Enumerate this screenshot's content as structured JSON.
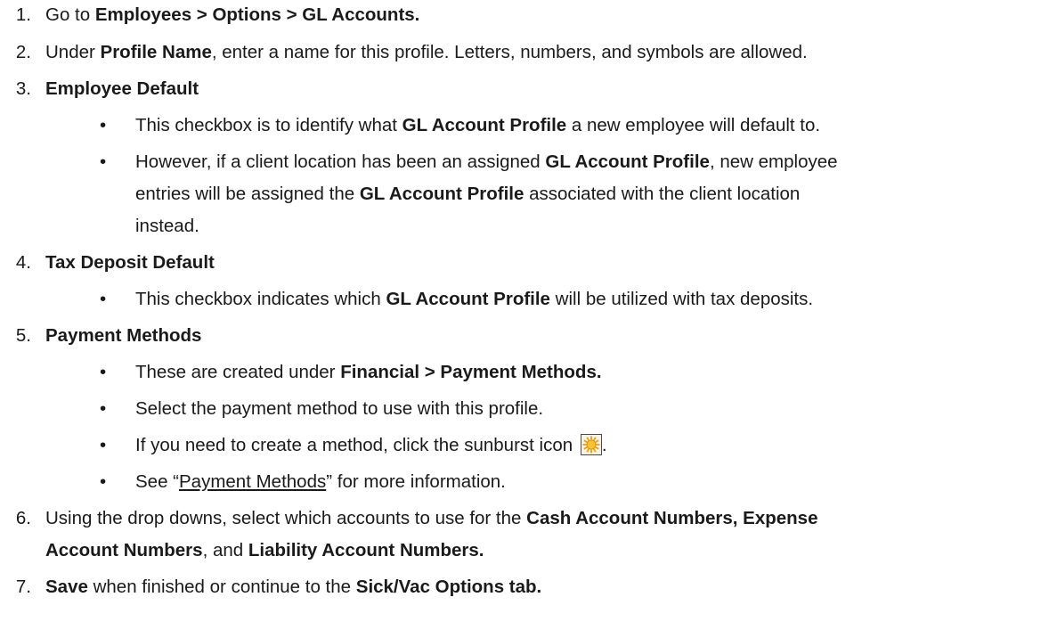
{
  "steps": [
    {
      "num": "1.",
      "parts": [
        {
          "t": "Go to "
        },
        {
          "t": "Employees > Options > GL Accounts.",
          "b": true
        }
      ]
    },
    {
      "num": "2.",
      "parts": [
        {
          "t": "Under "
        },
        {
          "t": "Profile Name",
          "b": true
        },
        {
          "t": ", enter a name for this profile. Letters, numbers, and symbols are allowed."
        }
      ]
    },
    {
      "num": "3.",
      "parts": [
        {
          "t": "Employee Default",
          "b": true
        }
      ]
    },
    {
      "num": "4.",
      "parts": [
        {
          "t": "Tax Deposit Default",
          "b": true
        }
      ]
    },
    {
      "num": "5.",
      "parts": [
        {
          "t": "Payment Methods",
          "b": true
        }
      ]
    },
    {
      "num": "6.",
      "parts": [
        {
          "t": "Using the drop downs, select which accounts to use for the "
        },
        {
          "t": "Cash Account Numbers, Expense",
          "b": true
        }
      ]
    },
    {
      "num": "",
      "parts": [
        {
          "t": "Account Numbers",
          "b": true
        },
        {
          "t": ", and "
        },
        {
          "t": "Liability Account Numbers.",
          "b": true
        }
      ]
    },
    {
      "num": "7.",
      "parts": [
        {
          "t": "Save",
          "b": true
        },
        {
          "t": " when finished or continue to the "
        },
        {
          "t": "Sick/Vac Options tab.",
          "b": true
        }
      ]
    }
  ],
  "bullets": [
    {
      "bullet": "•",
      "parts": [
        {
          "t": "This checkbox is to identify what "
        },
        {
          "t": "GL Account Profile",
          "b": true
        },
        {
          "t": " a new employee will default to."
        }
      ]
    },
    {
      "bullet": "•",
      "parts": [
        {
          "t": "However, if a client location has been an assigned "
        },
        {
          "t": "GL Account Profile",
          "b": true
        },
        {
          "t": ", new employee"
        }
      ]
    },
    {
      "bullet": "",
      "parts": [
        {
          "t": "entries will be assigned the "
        },
        {
          "t": "GL Account Profile",
          "b": true
        },
        {
          "t": " associated with the client location"
        }
      ]
    },
    {
      "bullet": "",
      "parts": [
        {
          "t": "instead."
        }
      ]
    },
    {
      "bullet": "•",
      "parts": [
        {
          "t": "This checkbox indicates which "
        },
        {
          "t": "GL Account Profile",
          "b": true
        },
        {
          "t": " will be utilized with tax deposits."
        }
      ]
    },
    {
      "bullet": "•",
      "parts": [
        {
          "t": "These are created under "
        },
        {
          "t": "Financial > Payment Methods.",
          "b": true
        }
      ]
    },
    {
      "bullet": "•",
      "parts": [
        {
          "t": "Select the payment method to use with this profile."
        }
      ]
    },
    {
      "bullet": "•",
      "parts": [
        {
          "t": "If you need to create a method, click the sunburst icon "
        },
        {
          "icon": "sunburst-icon"
        },
        {
          "t": "."
        }
      ]
    },
    {
      "bullet": "•",
      "parts": [
        {
          "t": "See “"
        },
        {
          "t": "Payment Methods",
          "link": true
        },
        {
          "t": "” for more information."
        }
      ]
    }
  ]
}
